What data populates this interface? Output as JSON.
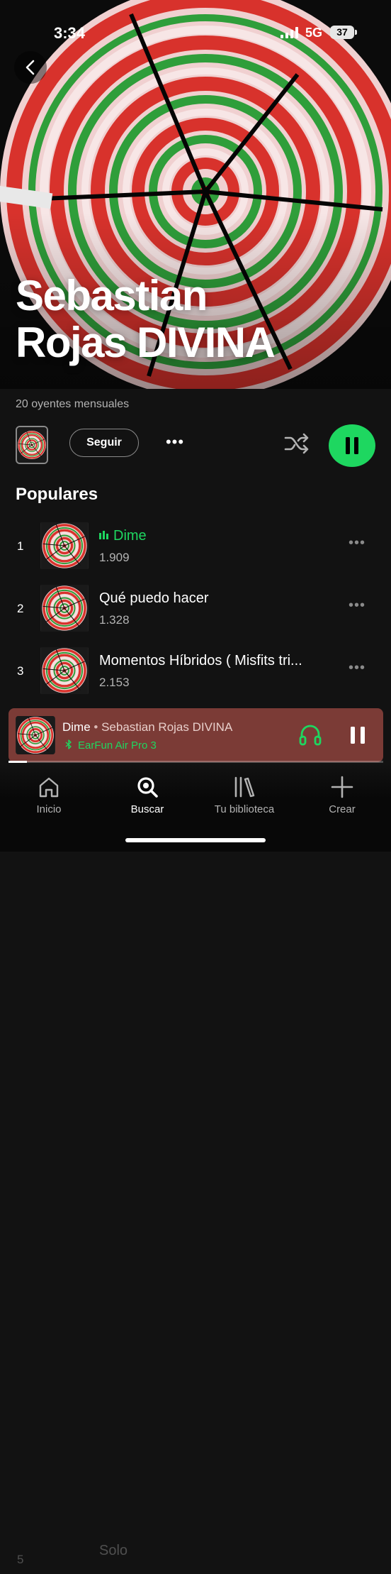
{
  "status_bar": {
    "time": "3:34",
    "network": "5G",
    "battery": "37"
  },
  "artist": {
    "name_line1": "Sebastian",
    "name_line2": "Rojas DIVINA",
    "monthly_listeners": "20 oyentes mensuales"
  },
  "controls": {
    "follow_label": "Seguir",
    "more_label": "•••",
    "play_state": "playing",
    "accent_color": "#1ed760"
  },
  "popular": {
    "title": "Populares",
    "tracks": [
      {
        "number": "1",
        "title": "Dime",
        "plays": "1.909",
        "playing": true
      },
      {
        "number": "2",
        "title": "Qué puedo hacer",
        "plays": "1.328",
        "playing": false
      },
      {
        "number": "3",
        "title": "Momentos Híbridos ( Misfits tri...",
        "plays": "2.153",
        "playing": false
      }
    ],
    "more_label": "•••"
  },
  "now_playing": {
    "song": "Dime",
    "separator": " • ",
    "artist": "Sebastian Rojas DIVINA",
    "device": "EarFun Air Pro 3",
    "progress": 0.05,
    "background_color": "#7b3b36"
  },
  "ghost_row_text": "Solo",
  "ghost_row_number": "5",
  "tabs": [
    {
      "label": "Inicio",
      "icon": "home-icon",
      "active": false
    },
    {
      "label": "Buscar",
      "icon": "search-icon",
      "active": true
    },
    {
      "label": "Tu biblioteca",
      "icon": "library-icon",
      "active": false
    },
    {
      "label": "Crear",
      "icon": "plus-icon",
      "active": false
    }
  ]
}
